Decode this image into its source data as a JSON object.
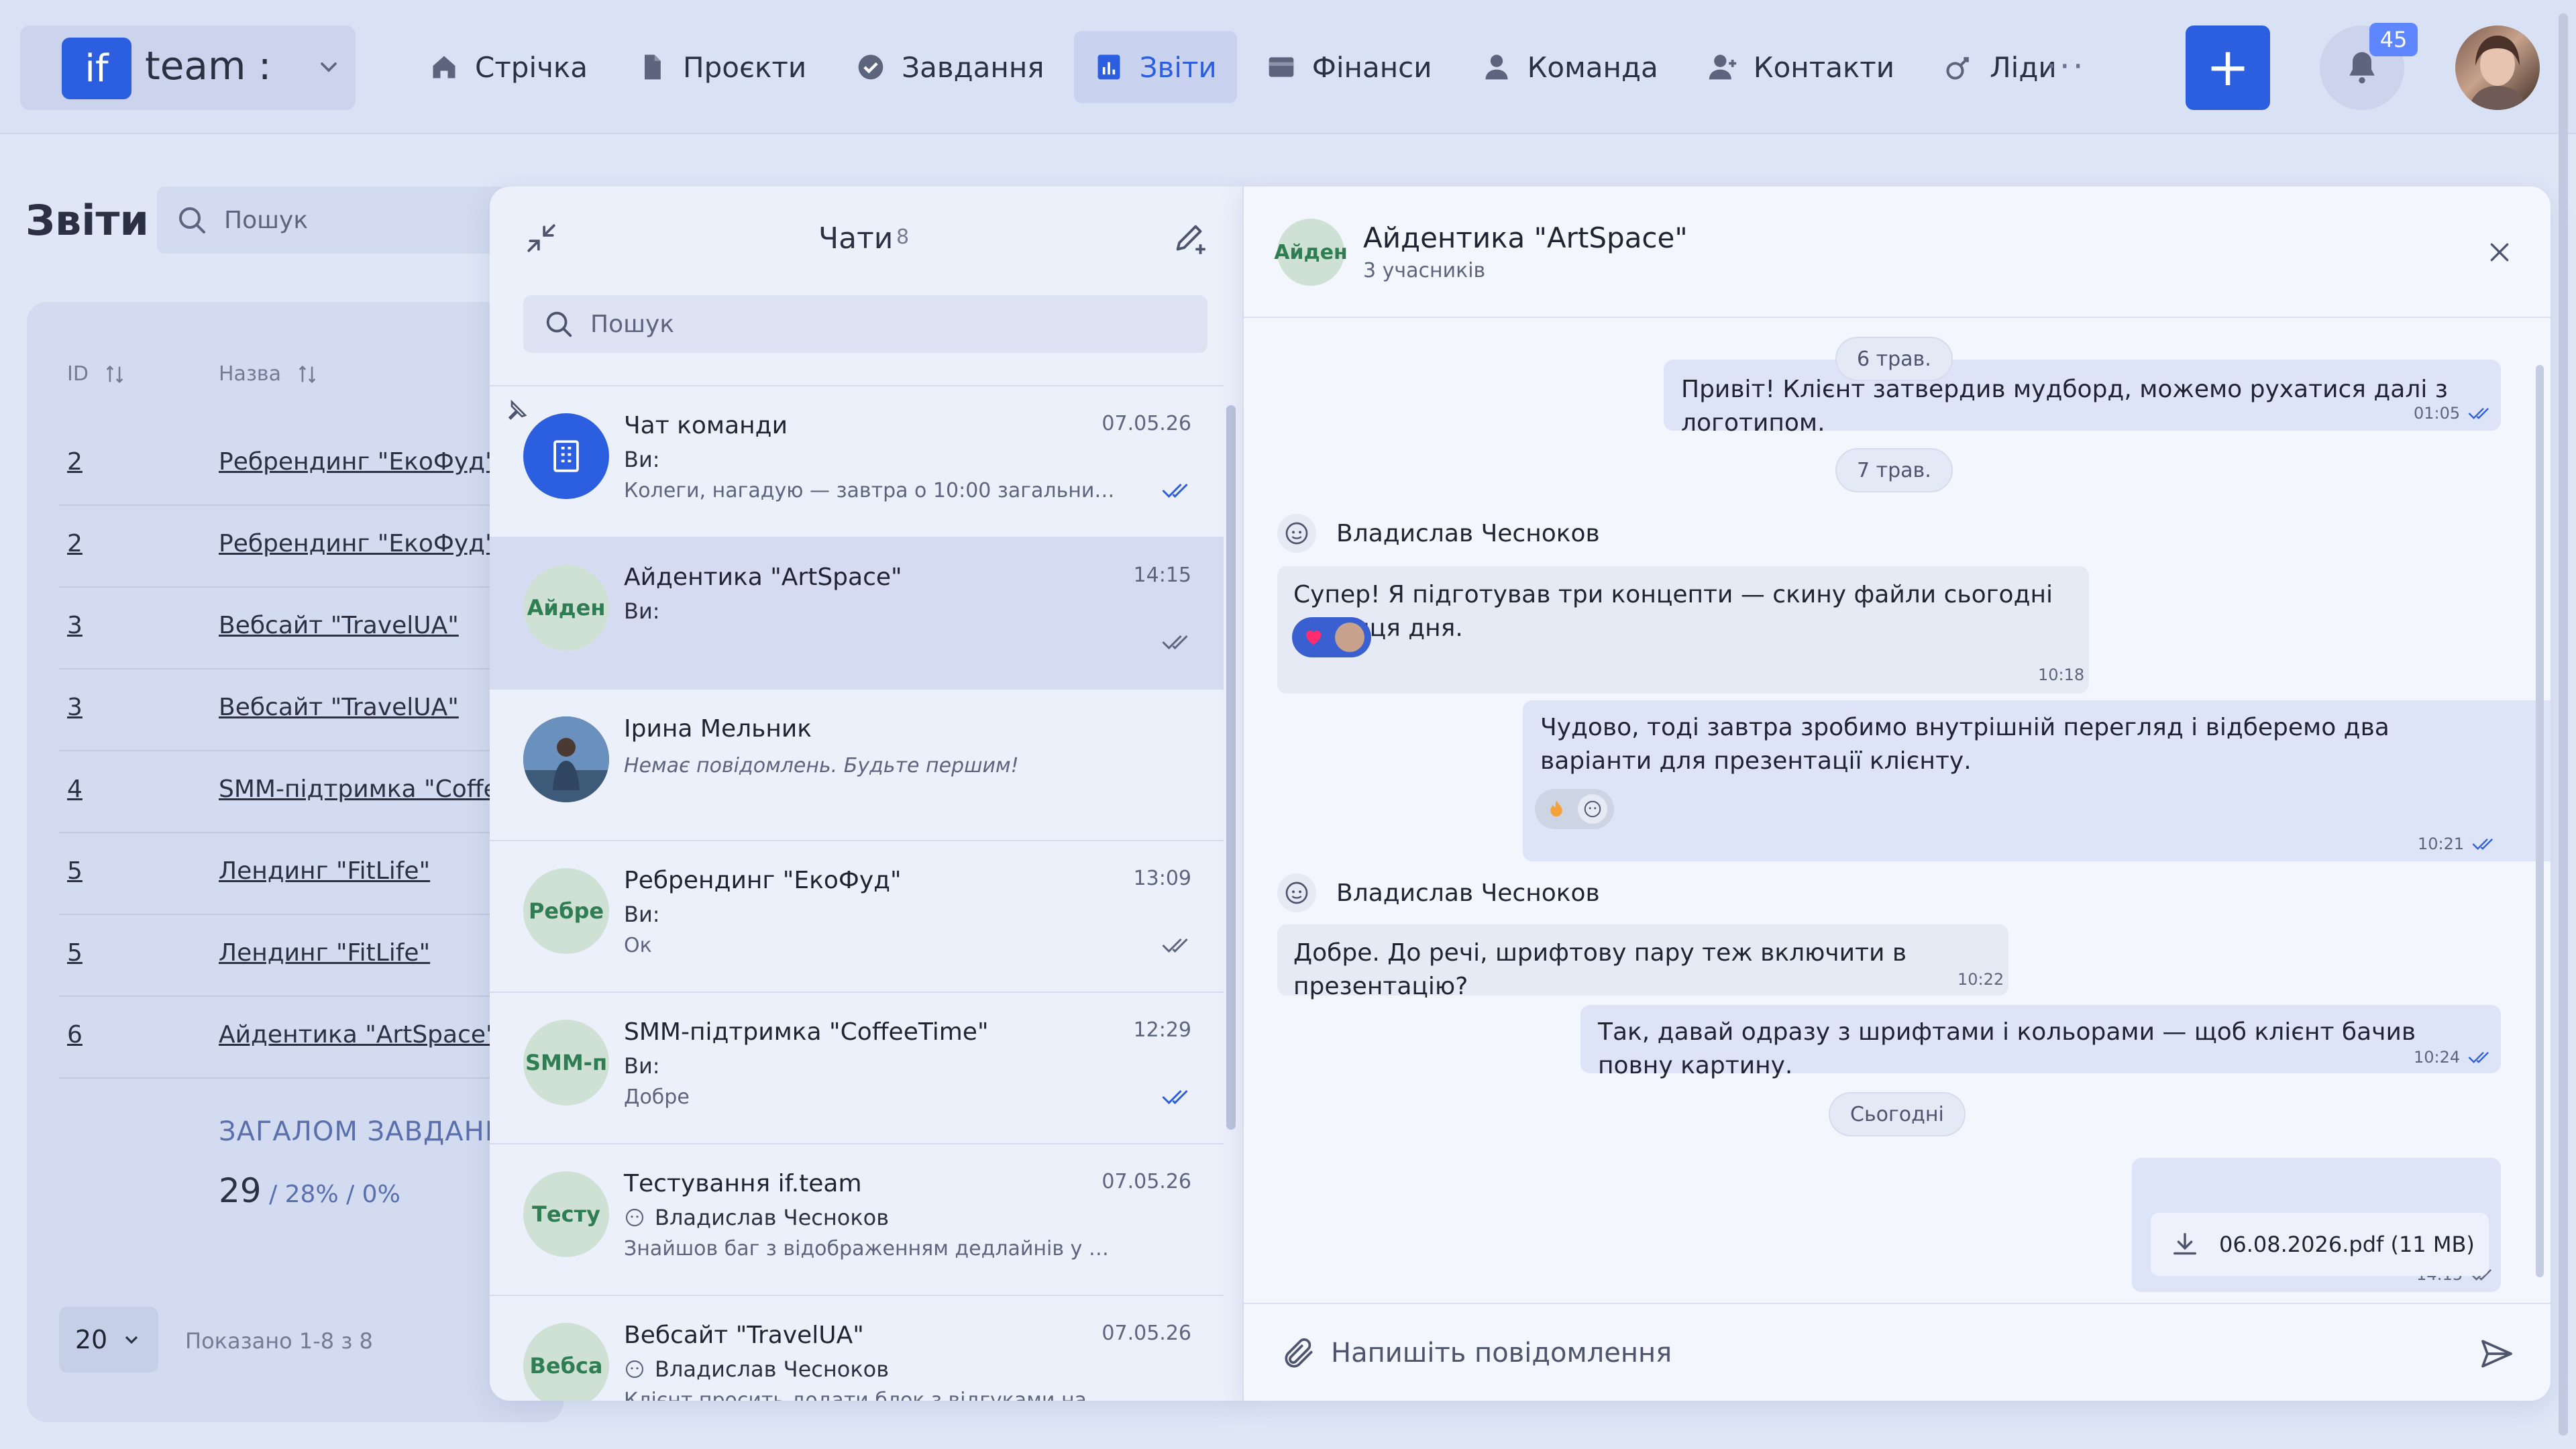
{
  "brand": {
    "logo": "if",
    "name": "team :"
  },
  "nav": {
    "items": [
      {
        "label": "Стрічка",
        "icon": "home-icon"
      },
      {
        "label": "Проєкти",
        "icon": "file-icon"
      },
      {
        "label": "Завдання",
        "icon": "check-circle-icon"
      },
      {
        "label": "Звіти",
        "icon": "report-icon"
      },
      {
        "label": "Фінанси",
        "icon": "wallet-icon"
      },
      {
        "label": "Команда",
        "icon": "user-icon"
      },
      {
        "label": "Контакти",
        "icon": "contacts-icon"
      },
      {
        "label": "Ліди",
        "icon": "leads-icon"
      }
    ],
    "more": "···",
    "add": "+",
    "notifications": "45",
    "accent": "#2c5fe0"
  },
  "page": {
    "title": "Звіти",
    "search_placeholder": "Пошук",
    "columns": {
      "id": "ID",
      "name": "Назва"
    },
    "rows": [
      {
        "id": "2",
        "name": "Ребрендинг \"ЕкоФуд\""
      },
      {
        "id": "2",
        "name": "Ребрендинг \"ЕкоФуд\""
      },
      {
        "id": "3",
        "name": "Вебсайт \"TravelUA\""
      },
      {
        "id": "3",
        "name": "Вебсайт \"TravelUA\""
      },
      {
        "id": "4",
        "name": "SMM-підтримка \"CoffeeTime\""
      },
      {
        "id": "5",
        "name": "Лендинг \"FitLife\""
      },
      {
        "id": "5",
        "name": "Лендинг \"FitLife\""
      },
      {
        "id": "6",
        "name": "Айдентика \"ArtSpace\""
      }
    ],
    "total_title": "ЗАГАЛОМ ЗАВДАНЬ",
    "total_count": "29",
    "total_pct": " / 28% / 0%",
    "per_page": "20",
    "shown": "Показано 1-8 з 8"
  },
  "chat_list": {
    "title": "Чати",
    "count": "8",
    "search_placeholder": "Пошук",
    "items": [
      {
        "avatar": "",
        "name": "Чат команди",
        "time": "07.05.26",
        "who": "Ви:",
        "preview": "Колеги, нагадую — завтра о 10:00 загальний ст...",
        "read": true
      },
      {
        "avatar": "Айден",
        "name": "Айдентика \"ArtSpace\"",
        "time": "14:15",
        "who": "Ви:",
        "preview": "",
        "read": true
      },
      {
        "avatar": "",
        "name": "Ірина Мельник",
        "time": "",
        "who": "",
        "preview": "Немає повідомлень. Будьте першим!",
        "read": false
      },
      {
        "avatar": "Ребре",
        "name": "Ребрендинг \"ЕкоФуд\"",
        "time": "13:09",
        "who": "Ви:",
        "preview": "Ок",
        "read": true
      },
      {
        "avatar": "SMM-п",
        "name": "SMM-підтримка \"CoffeeTime\"",
        "time": "12:29",
        "who": "Ви:",
        "preview": "Добре",
        "read": true
      },
      {
        "avatar": "Тесту",
        "name": "Тестування if.team",
        "time": "07.05.26",
        "who": "Владислав Чесноков",
        "preview": "Знайшов баг з відображенням дедлайнів у моб...",
        "read": false
      },
      {
        "avatar": "Вебса",
        "name": "Вебсайт \"TravelUA\"",
        "time": "07.05.26",
        "who": "Владислав Чесноков",
        "preview": "Клієнт просить додати блок з відгуками на гол...",
        "read": false
      }
    ]
  },
  "conversation": {
    "avatar": "Айден",
    "title": "Айдентика \"ArtSpace\"",
    "subtitle": "3 учасників",
    "dates": {
      "d1": "6 трав.",
      "d2": "7 трав.",
      "d3": "Сьогодні"
    },
    "messages": {
      "m1": {
        "text": "Привіт! Клієнт затвердив мудборд, можемо рухатися далі з логотипом.",
        "time": "01:05"
      },
      "sender1": "Владислав Чесноков",
      "m2": {
        "text": "Супер! Я підготував три концепти — скину файли сьогодні до кінця дня.",
        "time": "10:18"
      },
      "m3": {
        "text": "Чудово, тоді завтра зробимо внутрішній перегляд і відберемо два варіанти для презентації клієнту.",
        "time": "10:21"
      },
      "sender2": "Владислав Чесноков",
      "m4": {
        "text": "Добре. До речі, шрифтову пару теж включити в презентацію?",
        "time": "10:22"
      },
      "m5": {
        "text": "Так, давай одразу з шрифтами і кольорами — щоб клієнт бачив повну картину.",
        "time": "10:24"
      },
      "file": {
        "name": "06.08.2026.pdf (11 MB)",
        "time": "14:15"
      }
    },
    "input_placeholder": "Напишіть повідомлення"
  }
}
